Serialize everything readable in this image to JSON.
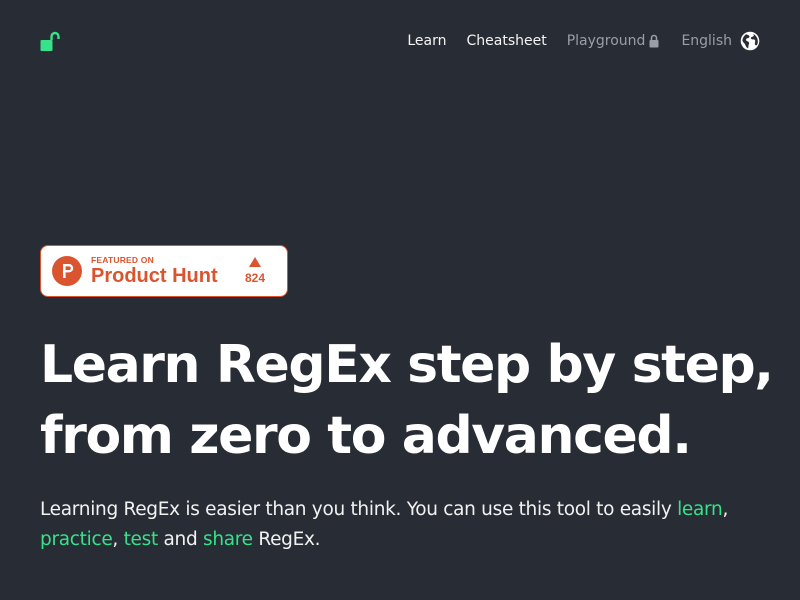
{
  "header": {
    "logo_icon": "open-lock-icon",
    "nav": {
      "learn": "Learn",
      "cheatsheet": "Cheatsheet",
      "playground": "Playground",
      "playground_icon": "lock-icon",
      "language": "English",
      "language_icon": "globe-icon"
    }
  },
  "product_hunt": {
    "featured": "FEATURED ON",
    "name": "Product Hunt",
    "votes": "824",
    "logo_icon": "product-hunt-p-icon",
    "vote_icon": "upvote-triangle-icon"
  },
  "hero": {
    "headline_line1": "Learn RegEx step by step,",
    "headline_line2": "from zero to advanced.",
    "lead_text1": "Learning RegEx is easier than you think. You can use this tool to easily ",
    "lead_link_learn": "learn",
    "lead_sep1": ",",
    "lead_link_practice": "practice",
    "lead_sep2": ", ",
    "lead_link_test": "test",
    "lead_and": " and ",
    "lead_link_share": "share",
    "lead_end": " RegEx."
  },
  "colors": {
    "background": "#282c34",
    "accent_green": "#36e28a",
    "product_hunt_orange": "#da552f",
    "muted_text": "#9a9ea6"
  }
}
